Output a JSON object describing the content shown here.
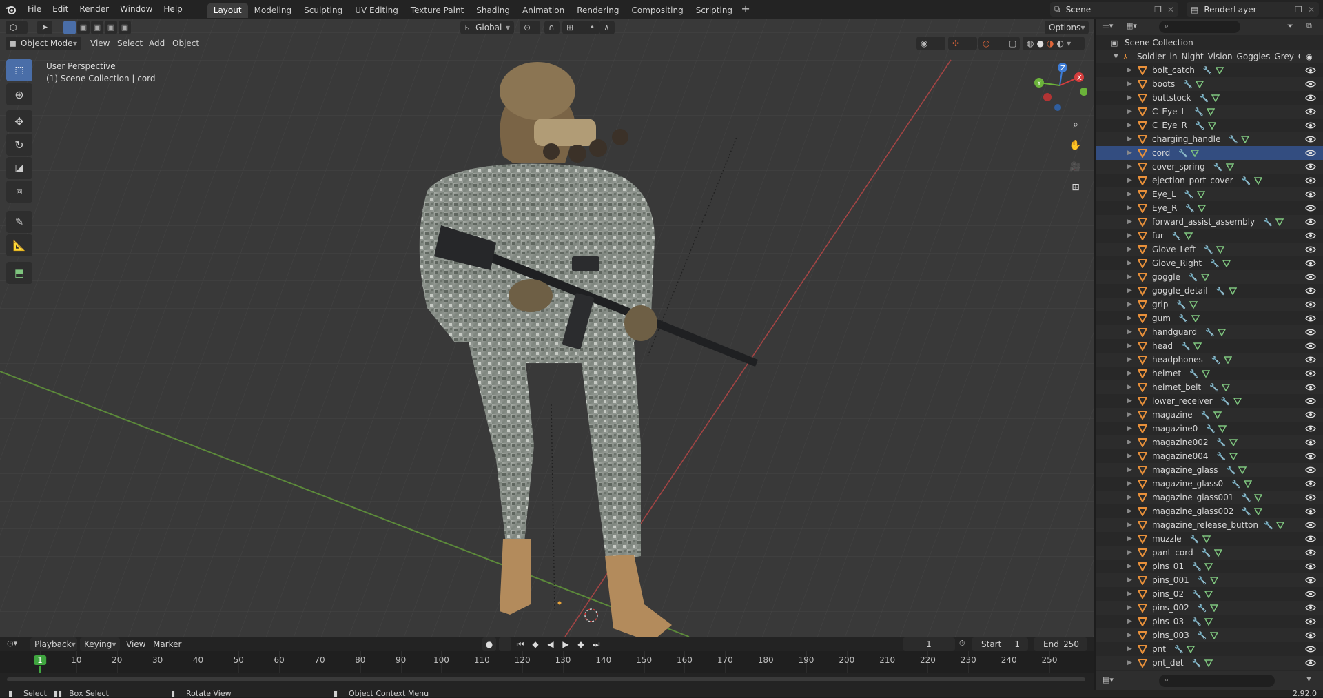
{
  "app": {
    "version": "2.92.0"
  },
  "menu": [
    "File",
    "Edit",
    "Render",
    "Window",
    "Help"
  ],
  "workspaces": [
    "Layout",
    "Modeling",
    "Sculpting",
    "UV Editing",
    "Texture Paint",
    "Shading",
    "Animation",
    "Rendering",
    "Compositing",
    "Scripting"
  ],
  "active_workspace": "Layout",
  "scene": {
    "name": "Scene",
    "view_layer": "RenderLayer"
  },
  "viewport": {
    "mode": "Object Mode",
    "menus": [
      "View",
      "Select",
      "Add",
      "Object"
    ],
    "transform_orientation": "Global",
    "options_label": "Options",
    "perspective_label": "User Perspective",
    "collection_label": "(1) Scene Collection | cord",
    "gizmo_axes": [
      "X",
      "Y",
      "Z"
    ]
  },
  "outliner": {
    "root": "Scene Collection",
    "collection": "Soldier_in_Night_Vision_Goggles_Grey_Camo",
    "objects": [
      "bolt_catch",
      "boots",
      "buttstock",
      "C_Eye_L",
      "C_Eye_R",
      "charging_handle",
      "cord",
      "cover_spring",
      "ejection_port_cover",
      "Eye_L",
      "Eye_R",
      "forward_assist_assembly",
      "fur",
      "Glove_Left",
      "Glove_Right",
      "goggle",
      "goggle_detail",
      "grip",
      "gum",
      "handguard",
      "head",
      "headphones",
      "helmet",
      "helmet_belt",
      "lower_receiver",
      "magazine",
      "magazine0",
      "magazine002",
      "magazine004",
      "magazine_glass",
      "magazine_glass0",
      "magazine_glass001",
      "magazine_glass002",
      "magazine_release_button",
      "muzzle",
      "pant_cord",
      "pins_01",
      "pins_001",
      "pins_02",
      "pins_002",
      "pins_03",
      "pins_003",
      "pnt",
      "pnt_det"
    ],
    "active_object": "cord"
  },
  "timeline": {
    "menus": [
      "Playback",
      "Keying",
      "View",
      "Marker"
    ],
    "current_frame": "1",
    "start_label": "Start",
    "start": "1",
    "end_label": "End",
    "end": "250",
    "ticks": [
      "1",
      "10",
      "20",
      "30",
      "40",
      "50",
      "60",
      "70",
      "80",
      "90",
      "100",
      "110",
      "120",
      "130",
      "140",
      "150",
      "160",
      "170",
      "180",
      "190",
      "200",
      "210",
      "220",
      "230",
      "240",
      "250"
    ]
  },
  "statusbar": {
    "select": "Select",
    "box_select": "Box Select",
    "rotate_view": "Rotate View",
    "context_menu": "Object Context Menu"
  },
  "colors": {
    "accent": "#4772b3",
    "object_icon": "#e8903a",
    "x_axis": "#d43d3d",
    "y_axis": "#6bb33a",
    "z_axis": "#3d7bd4"
  }
}
